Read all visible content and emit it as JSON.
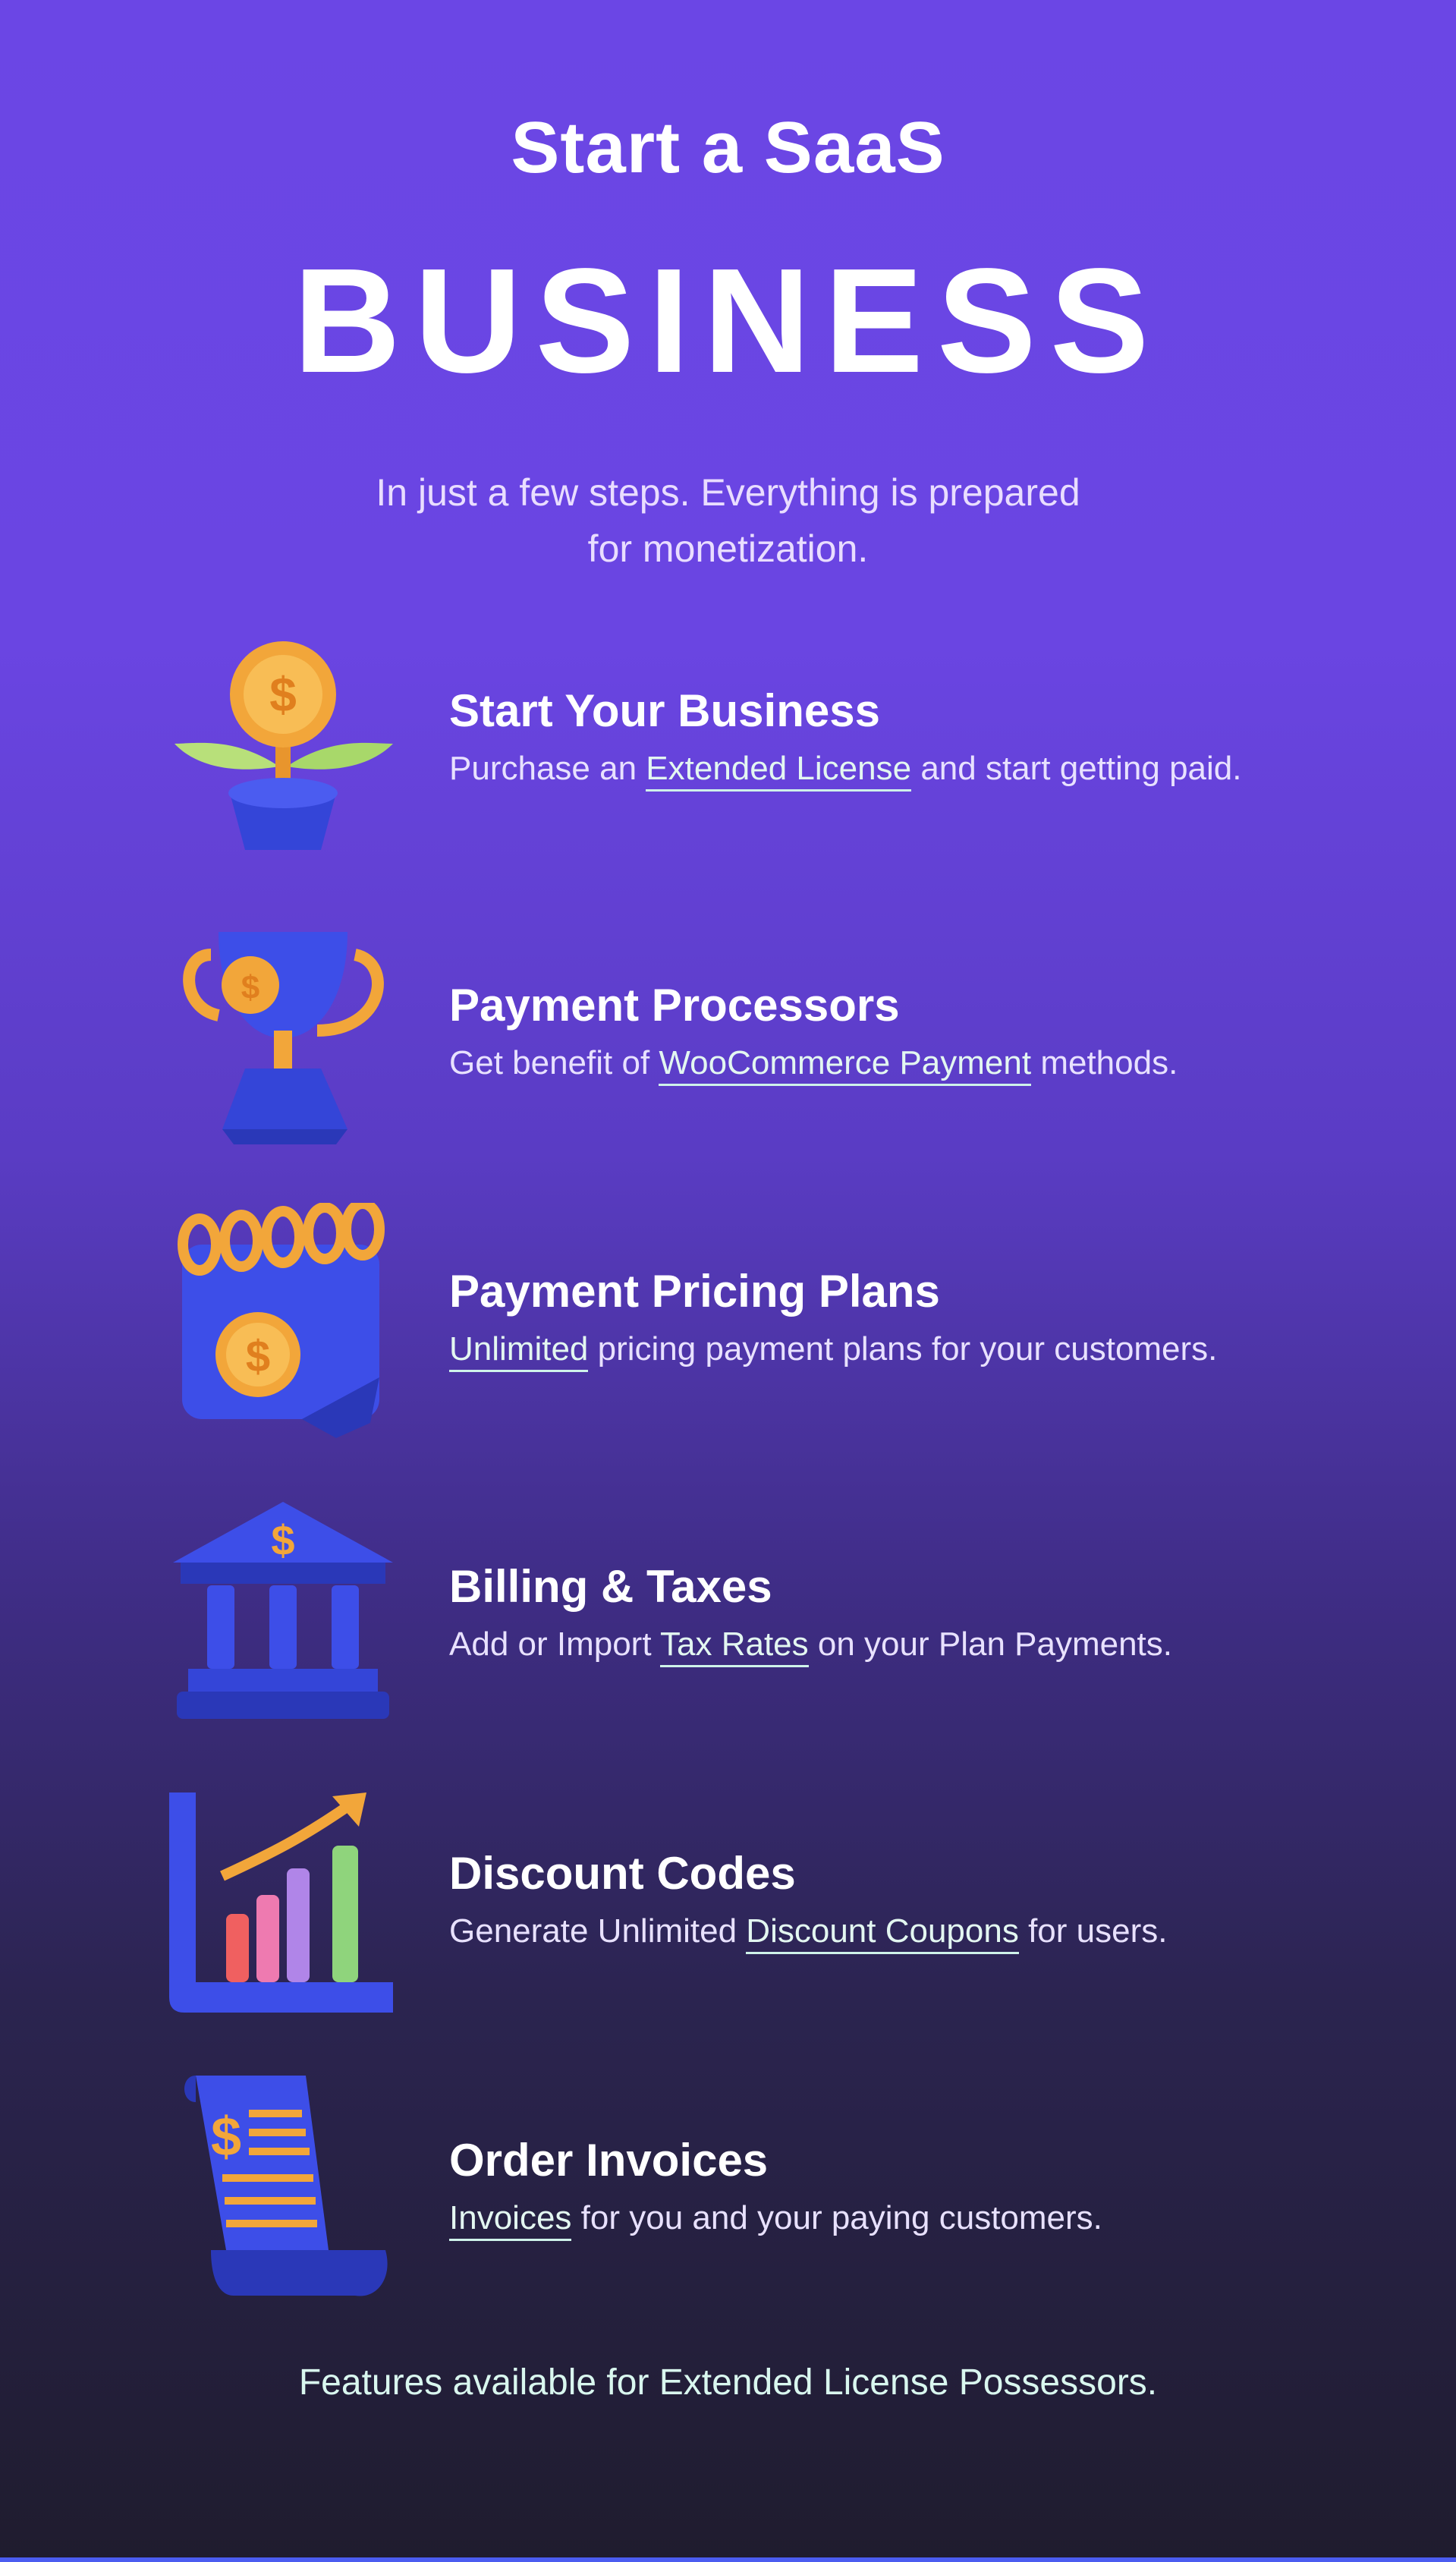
{
  "hero": {
    "kicker": "Start a SaaS",
    "headline": "BUSINESS",
    "intro_line1": "In just a few steps. Everything is prepared",
    "intro_line2": "for monetization."
  },
  "features": [
    {
      "icon": "money-plant-icon",
      "title": "Start Your Business",
      "desc_before": "Purchase an ",
      "desc_link": "Extended License",
      "desc_after": " and start getting paid."
    },
    {
      "icon": "trophy-coin-icon",
      "title": "Payment Processors",
      "desc_before": "Get benefit of ",
      "desc_link": "WooCommerce Payment",
      "desc_after": " methods."
    },
    {
      "icon": "calendar-coin-icon",
      "title": "Payment Pricing Plans",
      "desc_before": "",
      "desc_link": "Unlimited",
      "desc_after": " pricing payment plans for your customers."
    },
    {
      "icon": "bank-icon",
      "title": "Billing & Taxes",
      "desc_before": "Add or Import ",
      "desc_link": "Tax Rates",
      "desc_after": " on your Plan Payments."
    },
    {
      "icon": "growth-chart-icon",
      "title": "Discount Codes",
      "desc_before": "Generate Unlimited ",
      "desc_link": "Discount Coupons",
      "desc_after": " for users."
    },
    {
      "icon": "invoice-scroll-icon",
      "title": "Order Invoices",
      "desc_before": "",
      "desc_link": "Invoices",
      "desc_after": " for you and your paying customers."
    }
  ],
  "footer_note": "Features available for Extended License Possessors.",
  "colors": {
    "background_top": "#6b46e5",
    "background_bottom": "#1f1c2e",
    "icon_blue": "#3d4ee8",
    "icon_gold": "#f2a63a",
    "link_mint": "#cff3ea"
  }
}
